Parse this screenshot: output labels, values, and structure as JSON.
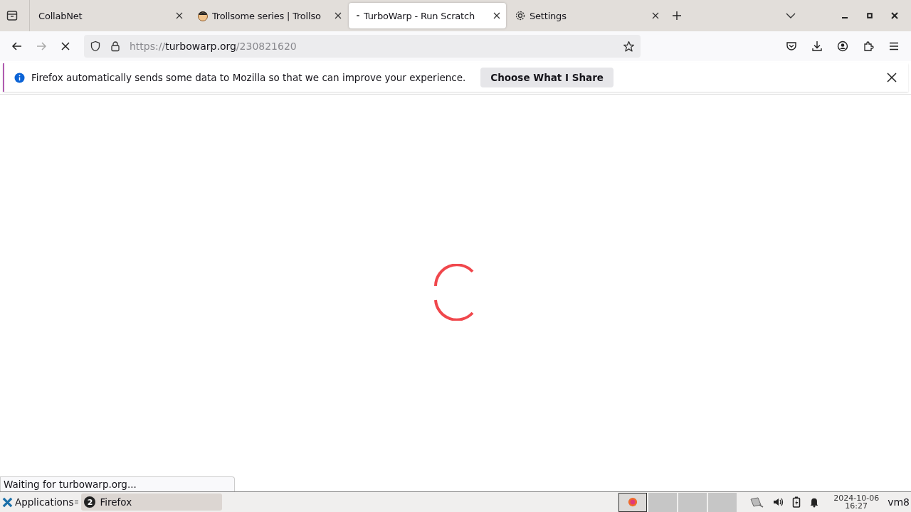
{
  "tabs": [
    {
      "title": "CollabNet",
      "kind": "plain",
      "selected": false
    },
    {
      "title": "Trollsome series | Trollso",
      "kind": "face",
      "selected": false
    },
    {
      "title": "TurboWarp - Run Scratch",
      "kind": "loading",
      "selected": true
    },
    {
      "title": "Settings",
      "kind": "gear",
      "selected": false
    }
  ],
  "navigation": {
    "forward_disabled": true,
    "loading": true
  },
  "address_bar": {
    "scheme": "https://",
    "host": "turbowarp.org",
    "path": "/230821620"
  },
  "notification": {
    "message": "Firefox automatically sends some data to Mozilla so that we can improve your experience.",
    "button": "Choose What I Share"
  },
  "status_text": "Waiting for turbowarp.org...",
  "taskbar": {
    "menu": "Applications",
    "window": {
      "title": "Firefox",
      "count": "2"
    },
    "workspaces": [
      {
        "selected": true
      },
      {
        "selected": false
      },
      {
        "selected": false
      },
      {
        "selected": false
      }
    ],
    "clock": {
      "date": "2024-10-06",
      "time": "16:27"
    },
    "user": "vm8"
  }
}
